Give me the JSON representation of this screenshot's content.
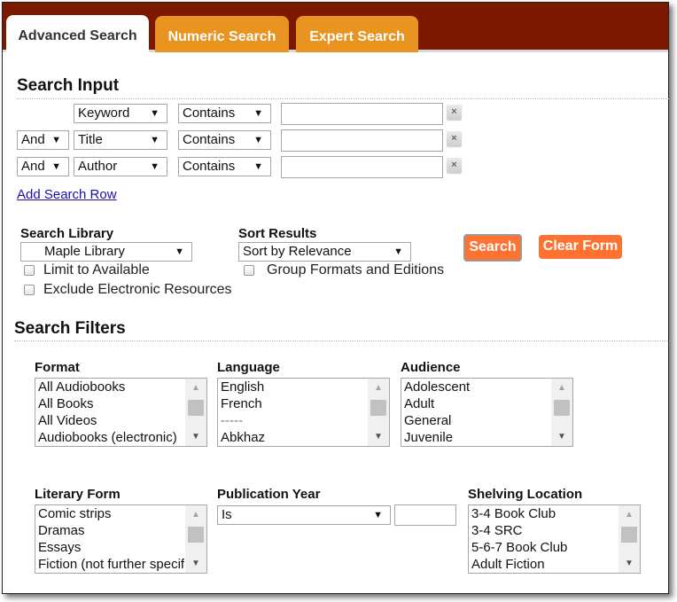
{
  "tabs": [
    {
      "label": "Advanced Search",
      "active": true
    },
    {
      "label": "Numeric Search",
      "active": false
    },
    {
      "label": "Expert Search",
      "active": false
    }
  ],
  "search_input": {
    "title": "Search Input",
    "rows": [
      {
        "bool": "",
        "field": "Keyword",
        "op": "Contains",
        "value": ""
      },
      {
        "bool": "And",
        "field": "Title",
        "op": "Contains",
        "value": ""
      },
      {
        "bool": "And",
        "field": "Author",
        "op": "Contains",
        "value": ""
      }
    ],
    "remove_icon": "×",
    "add_row_label": "Add Search Row"
  },
  "library": {
    "label": "Search Library",
    "selected": "Maple Library",
    "limit_available": "Limit to Available",
    "exclude_electronic": "Exclude Electronic Resources"
  },
  "sort": {
    "label": "Sort Results",
    "selected": "Sort by Relevance",
    "group_formats": "Group Formats and Editions"
  },
  "buttons": {
    "search": "Search",
    "clear": "Clear Form"
  },
  "filters": {
    "title": "Search Filters",
    "format": {
      "label": "Format",
      "options": [
        "All Audiobooks",
        "All Books",
        "All Videos",
        "Audiobooks (electronic)"
      ]
    },
    "language": {
      "label": "Language",
      "options": [
        "English",
        "French",
        "-----",
        "Abkhaz"
      ]
    },
    "audience": {
      "label": "Audience",
      "options": [
        "Adolescent",
        "Adult",
        "General",
        "Juvenile"
      ]
    },
    "literary_form": {
      "label": "Literary Form",
      "options": [
        "Comic strips",
        "Dramas",
        "Essays",
        "Fiction (not further specif"
      ]
    },
    "pub_year": {
      "label": "Publication Year",
      "selected": "Is",
      "value": ""
    },
    "shelving": {
      "label": "Shelving Location",
      "options": [
        "3-4 Book Club",
        "3-4 SRC",
        "5-6-7 Book Club",
        "Adult Fiction"
      ]
    }
  },
  "icons": {
    "arrow": "▼",
    "up": "▲",
    "down": "▼"
  }
}
